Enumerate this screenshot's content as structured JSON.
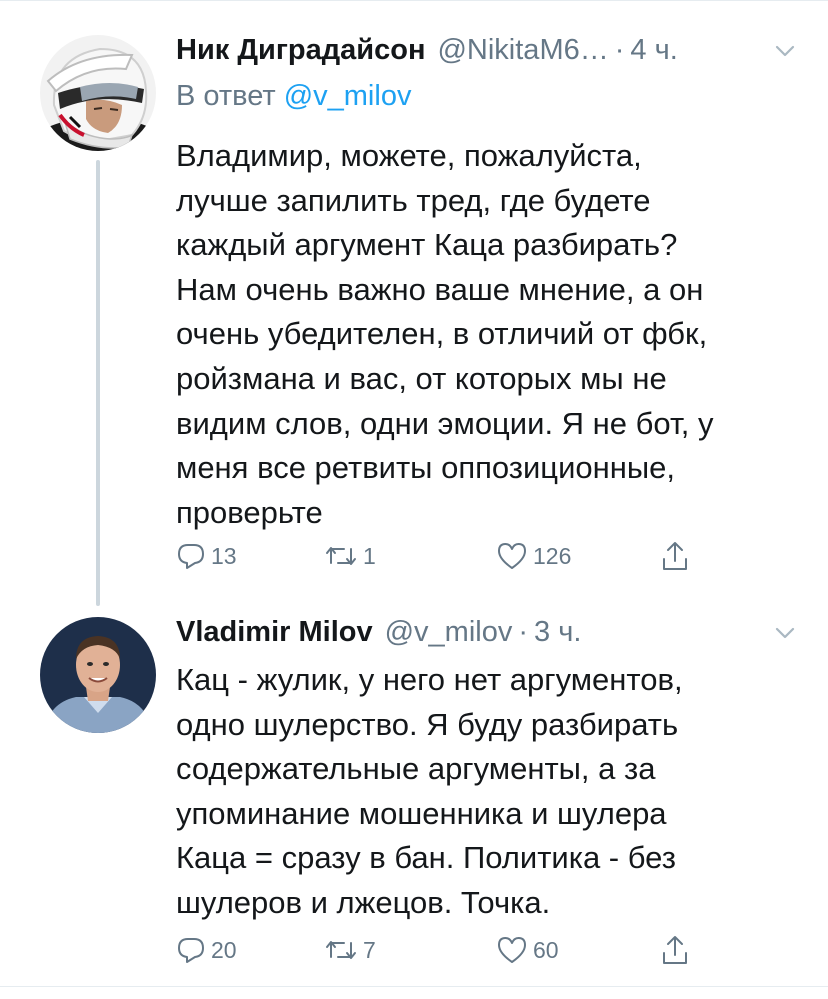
{
  "tweets": [
    {
      "author": {
        "display_name": "Ник Диградайсон",
        "handle": "@NikitaM6…",
        "avatar": "avatar-motocross-helmet"
      },
      "time": "4 ч.",
      "separator": "·",
      "reply_to": {
        "prefix": "В ответ",
        "mention": "@v_milov"
      },
      "text_lines": [
        "Владимир, можете, пожалуйста,",
        "лучше запилить тред, где будете",
        "каждый аргумент Каца разбирать?",
        "Нам очень важно ваше мнение, а он",
        "очень убедителен, в отличий от фбк,",
        "ройзмана и вас, от которых мы не",
        "видим слов, одни эмоции. Я не бот, у",
        "меня все ретвиты оппозиционные,",
        "проверьте"
      ],
      "actions": {
        "replies": "13",
        "retweets": "1",
        "likes": "126"
      }
    },
    {
      "author": {
        "display_name": "Vladimir Milov",
        "handle": "@v_milov",
        "avatar": "avatar-man-portrait"
      },
      "time": "3 ч.",
      "separator": "·",
      "text_lines": [
        "Кац - жулик, у него нет аргументов,",
        "одно шулерство. Я буду разбирать",
        "содержательные аргументы, а за",
        "упоминание мошенника и шулера",
        "Каца = сразу в бан. Политика - без",
        "шулеров и лжецов. Точка."
      ],
      "actions": {
        "replies": "20",
        "retweets": "7",
        "likes": "60"
      }
    }
  ],
  "icons": {
    "reply": "reply-bubble-icon",
    "retweet": "retweet-arrows-icon",
    "like": "heart-icon",
    "share": "share-upload-icon",
    "menu": "chevron-down-icon"
  },
  "colors": {
    "text": "#14171a",
    "secondary": "#657786",
    "link": "#1da1f2",
    "divider": "#e6ecf0",
    "thread_line": "#ccd6dd"
  }
}
